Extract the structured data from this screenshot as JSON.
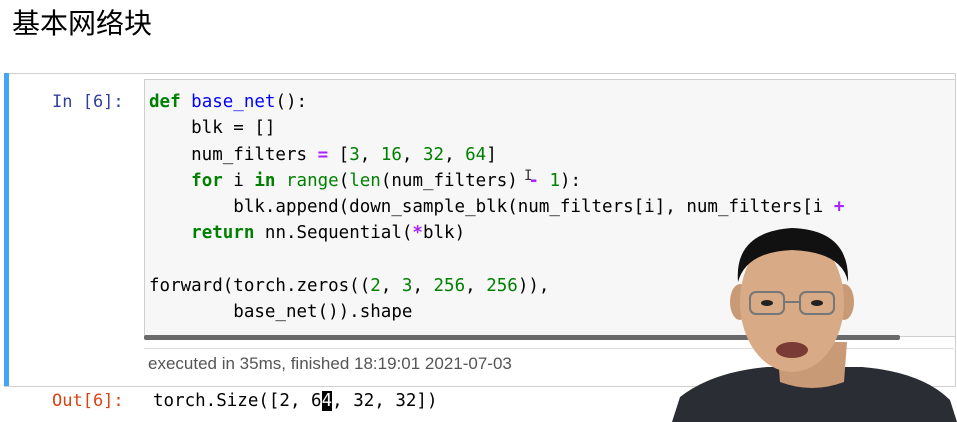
{
  "page": {
    "heading": "基本网络块"
  },
  "cell": {
    "in_prompt": "In [6]:",
    "code": {
      "l1_def": "def",
      "l1_name": "base_net",
      "l1_rest": "():",
      "l2": "    blk = []",
      "l3_a": "    num_filters ",
      "l3_eq": "=",
      "l3_b": " [",
      "l3_n1": "3",
      "l3_c1": ", ",
      "l3_n2": "16",
      "l3_c2": ", ",
      "l3_n3": "32",
      "l3_c3": ", ",
      "l3_n4": "64",
      "l3_end": "]",
      "l4_for": "for",
      "l4_i": " i ",
      "l4_in": "in",
      "l4_sp": " ",
      "l4_range": "range",
      "l4_p": "(",
      "l4_len": "len",
      "l4_mid": "(num_filters) ",
      "l4_minus": "-",
      "l4_sp2": " ",
      "l4_one": "1",
      "l4_end": "):",
      "l5_a": "        blk.append(down_sample_blk(num_filters[i], num_filters[i ",
      "l5_plus": "+",
      "l6_ret": "return",
      "l6_rest": " nn.Sequential(",
      "l6_star": "*",
      "l6_end": "blk)",
      "l8_a": "forward(torch.zeros((",
      "l8_n1": "2",
      "l8_c1": ", ",
      "l8_n2": "3",
      "l8_c2": ", ",
      "l8_n3": "256",
      "l8_c3": ", ",
      "l8_n4": "256",
      "l8_end": ")),",
      "l9": "        base_net()).shape"
    },
    "execution_info": "executed in 35ms, finished 18:19:01 2021-07-03",
    "out_prompt": "Out[6]:",
    "output_a": "torch.Size([2, 6",
    "output_hl": "4",
    "output_b": ", 32, 32])"
  },
  "colors": {
    "cell_selected_bar": "#42a5f5",
    "in_prompt": "#303f9f",
    "out_prompt": "#d84315",
    "keyword": "#008000",
    "function_name": "#0000ff",
    "operator": "#aa22ff"
  },
  "presenter": {
    "icon": "presenter-webcam-person"
  }
}
